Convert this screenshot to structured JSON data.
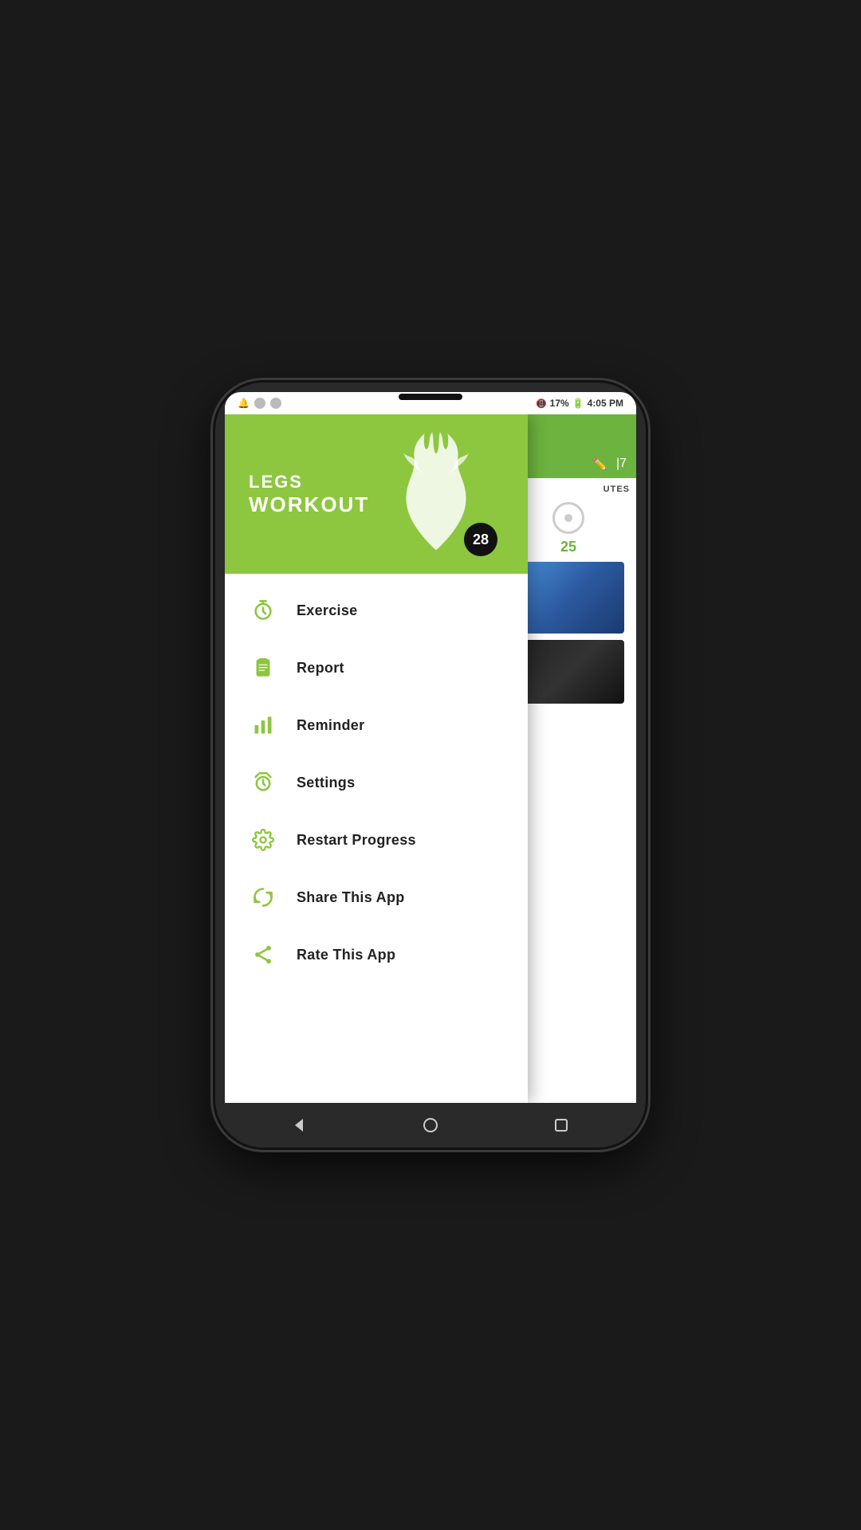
{
  "status_bar": {
    "battery": "17%",
    "time": "4:05 PM"
  },
  "drawer": {
    "header": {
      "title_top": "LEGS",
      "title_bottom": "WORKOUT",
      "badge_number": "28"
    },
    "menu_items": [
      {
        "id": "exercise",
        "label": "Exercise",
        "icon": "stopwatch"
      },
      {
        "id": "report",
        "label": "Report",
        "icon": "clipboard"
      },
      {
        "id": "reminder",
        "label": "Reminder",
        "icon": "bar-chart"
      },
      {
        "id": "settings",
        "label": "Settings",
        "icon": "alarm-clock"
      },
      {
        "id": "restart",
        "label": "Restart Progress",
        "icon": "gear"
      },
      {
        "id": "share",
        "label": "Share This App",
        "icon": "share-refresh"
      },
      {
        "id": "rate",
        "label": "Rate This App",
        "icon": "share-nodes"
      }
    ]
  },
  "background": {
    "label": "UTES",
    "number": "25"
  },
  "nav": {
    "back_label": "◀",
    "home_label": "●",
    "recent_label": "■"
  }
}
